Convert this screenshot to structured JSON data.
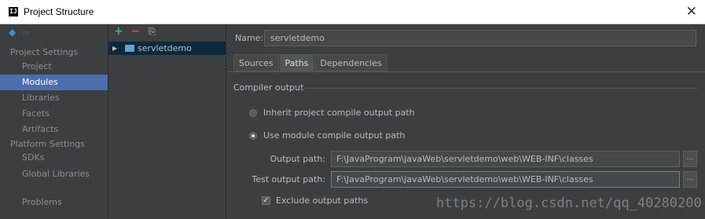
{
  "window": {
    "app_icon": "IJ",
    "title": "Project Structure",
    "close": "✕"
  },
  "nav": {
    "back_icon": "◆",
    "forward_icon": "⇨",
    "project_settings_header": "Project Settings",
    "project_settings_items": [
      "Project",
      "Modules",
      "Libraries",
      "Facets",
      "Artifacts"
    ],
    "platform_settings_header": "Platform Settings",
    "platform_settings_items": [
      "SDKs",
      "Global Libraries"
    ],
    "problems": "Problems",
    "selected": "Modules"
  },
  "tree": {
    "add_icon": "+",
    "remove_icon": "−",
    "copy_icon": "⎘",
    "module": "servletdemo"
  },
  "main": {
    "name_label": "Name:",
    "name_value": "servletdemo",
    "tabs": [
      "Sources",
      "Paths",
      "Dependencies"
    ],
    "active_tab": "Paths",
    "group_title": "Compiler output",
    "radio_inherit": "Inherit project compile output path",
    "radio_use_module": "Use module compile output path",
    "output_path_label": "Output path:",
    "output_path_value": "F:\\JavaProgram\\javaWeb\\servletdemo\\web\\WEB-INF\\classes",
    "test_output_path_label": "Test output path:",
    "test_output_path_value": "F:\\JavaProgram\\javaWeb\\servletdemo\\web\\WEB-INF\\classes",
    "browse_label": "...",
    "exclude_label": "Exclude output paths",
    "exclude_checked": "✓"
  },
  "watermark": "https://blog.csdn.net/qq_40280200",
  "colors": {
    "selection": "#4b6eaf",
    "background": "#3c3f41",
    "focus_border": "#4a88c7"
  }
}
